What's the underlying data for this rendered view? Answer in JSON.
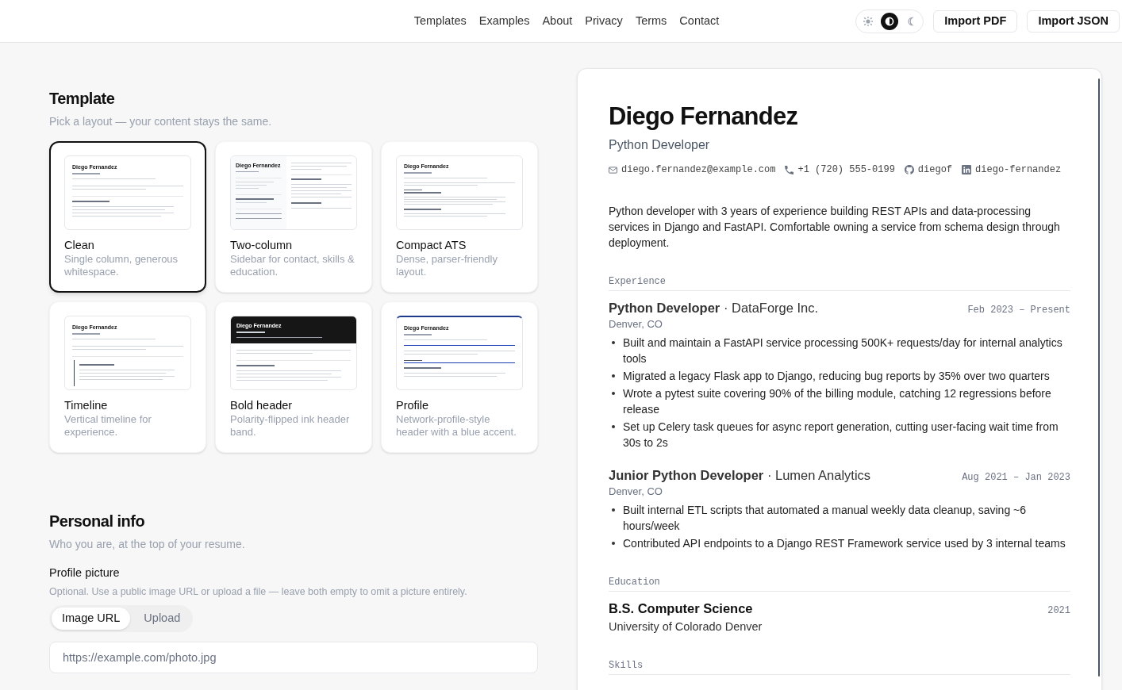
{
  "nav": {
    "links": [
      "Templates",
      "Examples",
      "About",
      "Privacy",
      "Terms",
      "Contact"
    ],
    "theme_modes": [
      {
        "kind": "light",
        "selected": false
      },
      {
        "kind": "system",
        "selected": true
      },
      {
        "kind": "dark",
        "selected": false
      }
    ],
    "buttons": [
      "Import PDF",
      "Import JSON"
    ]
  },
  "template": {
    "title": "Template",
    "subtitle": "Pick a layout — your content stays the same.",
    "options": [
      {
        "kind": "clean",
        "name": "Clean",
        "description": "Single column, generous whitespace.",
        "preview_name": "Diego Fernandez",
        "selected": true
      },
      {
        "kind": "two-column",
        "name": "Two-column",
        "description": "Sidebar for contact, skills & education.",
        "preview_name": "Diego Fernandez",
        "selected": false
      },
      {
        "kind": "compact",
        "name": "Compact ATS",
        "description": "Dense, parser-friendly layout.",
        "preview_name": "Diego Fernandez",
        "selected": false
      },
      {
        "kind": "timeline",
        "name": "Timeline",
        "description": "Vertical timeline for experience.",
        "preview_name": "Diego Fernandez",
        "selected": false
      },
      {
        "kind": "bold-header",
        "name": "Bold header",
        "description": "Polarity-flipped ink header band.",
        "preview_name": "Diego Fernandez",
        "selected": false
      },
      {
        "kind": "profile",
        "name": "Profile",
        "description": "Network-profile-style header with a blue accent.",
        "preview_name": "Diego Fernandez",
        "selected": false
      }
    ]
  },
  "personal_info": {
    "title": "Personal info",
    "subtitle": "Who you are, at the top of your resume.",
    "profile_picture": {
      "label": "Profile picture",
      "hint": "Optional. Use a public image URL or upload a file — leave both empty to omit a picture entirely.",
      "tabs": [
        {
          "label": "Image URL",
          "selected": true
        },
        {
          "label": "Upload",
          "selected": false
        }
      ],
      "placeholder": "https://example.com/photo.jpg"
    }
  },
  "resume": {
    "name": "Diego Fernandez",
    "title": "Python Developer",
    "contacts": [
      {
        "kind": "email",
        "text": "diego.fernandez@example.com"
      },
      {
        "kind": "phone",
        "text": "+1 (720) 555-0199"
      },
      {
        "kind": "github",
        "text": "diegof"
      },
      {
        "kind": "linkedin",
        "text": "diego-fernandez"
      }
    ],
    "summary": "Python developer with 3 years of experience building REST APIs and data-processing services in Django and FastAPI. Comfortable owning a service from schema design through deployment.",
    "sections": [
      {
        "kind": "experience",
        "heading": "Experience",
        "entries": [
          {
            "heading": "**Python Developer** · DataForge Inc.",
            "dates": "Feb 2023 – Present",
            "location": "Denver, CO",
            "bullets": [
              "Built and maintain a FastAPI service processing 500K+ requests/day for internal analytics tools",
              "Migrated a legacy Flask app to Django, reducing bug reports by 35% over two quarters",
              "Wrote a pytest suite covering 90% of the billing module, catching 12 regressions before release",
              "Set up Celery task queues for async report generation, cutting user-facing wait time from 30s to 2s"
            ]
          },
          {
            "heading": "**Junior Python Developer** · Lumen Analytics",
            "dates": "Aug 2021 – Jan 2023",
            "location": "Denver, CO",
            "bullets": [
              "Built internal ETL scripts that automated a manual weekly data cleanup, saving ~6 hours/week",
              "Contributed API endpoints to a Django REST Framework service used by 3 internal teams"
            ]
          }
        ]
      },
      {
        "kind": "education",
        "heading": "Education",
        "entries": [
          {
            "degree": "B.S. Computer Science",
            "year": "2021",
            "school": "University of Colorado Denver"
          }
        ]
      },
      {
        "kind": "skills",
        "heading": "Skills"
      }
    ]
  }
}
